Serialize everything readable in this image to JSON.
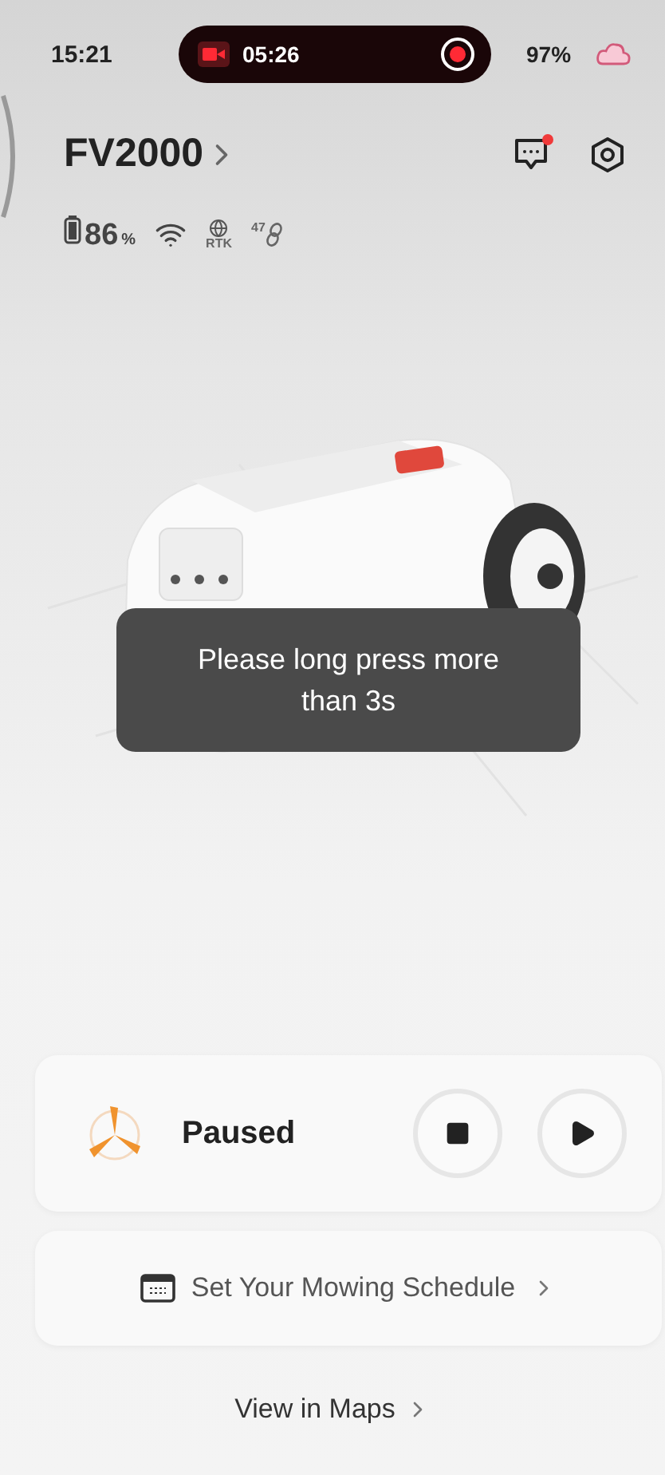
{
  "status_bar": {
    "time": "15:21",
    "recording_time": "05:26",
    "battery": "97%"
  },
  "device": {
    "name": "FV2000",
    "messages_unread": true,
    "battery_value": "86",
    "battery_unit": "%",
    "rtk_label": "RTK",
    "satellites": "47"
  },
  "toast": {
    "text": "Please long press more than 3s"
  },
  "control_card": {
    "status": "Paused"
  },
  "schedule_link": {
    "label": "Set Your Mowing Schedule"
  },
  "maps_link": {
    "label": "View in Maps"
  }
}
